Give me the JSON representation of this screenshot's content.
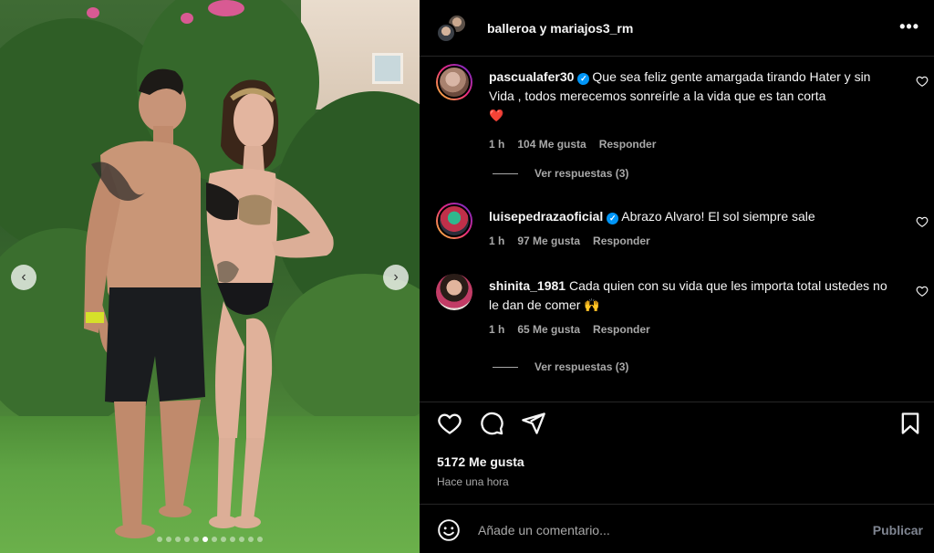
{
  "post": {
    "carousel_dot_count": 12,
    "carousel_active_index": 5
  },
  "header": {
    "title": "balleroa y mariajos3_rm",
    "more_label": "•••"
  },
  "comments": [
    {
      "username": "pascualafer30",
      "verified": true,
      "text": "Que sea feliz gente amargada tirando Hater y sin Vida , todos merecemos sonreírle a la vida que es tan corta",
      "emoji": "❤️",
      "time": "1 h",
      "likes": "104 Me gusta",
      "reply_label": "Responder",
      "replies_label": "Ver respuestas (3)"
    },
    {
      "username": "luisepedrazaoficial",
      "verified": true,
      "text": "Abrazo Alvaro! El sol siempre sale",
      "time": "1 h",
      "likes": "97 Me gusta",
      "reply_label": "Responder"
    },
    {
      "username": "shinita_1981",
      "verified": false,
      "text": "Cada quien con su vida que les importa total ustedes no le dan de comer",
      "emoji": "🙌",
      "time": "1 h",
      "likes": "65 Me gusta",
      "reply_label": "Responder",
      "replies_label": "Ver respuestas (3)"
    }
  ],
  "footer": {
    "likes": "5172 Me gusta",
    "time": "Hace una hora",
    "comment_placeholder": "Añade un comentario...",
    "publish_label": "Publicar"
  },
  "icons": {
    "like": "heart-icon",
    "comment": "comment-icon",
    "share": "share-icon",
    "save": "bookmark-icon",
    "emoji": "emoji-icon",
    "more": "more-icon"
  },
  "colors": {
    "background": "#000000",
    "text": "#f5f5f5",
    "muted": "#a8a8a8",
    "verified": "#0095f6",
    "divider": "#262626",
    "publish_disabled": "#7f8591"
  }
}
